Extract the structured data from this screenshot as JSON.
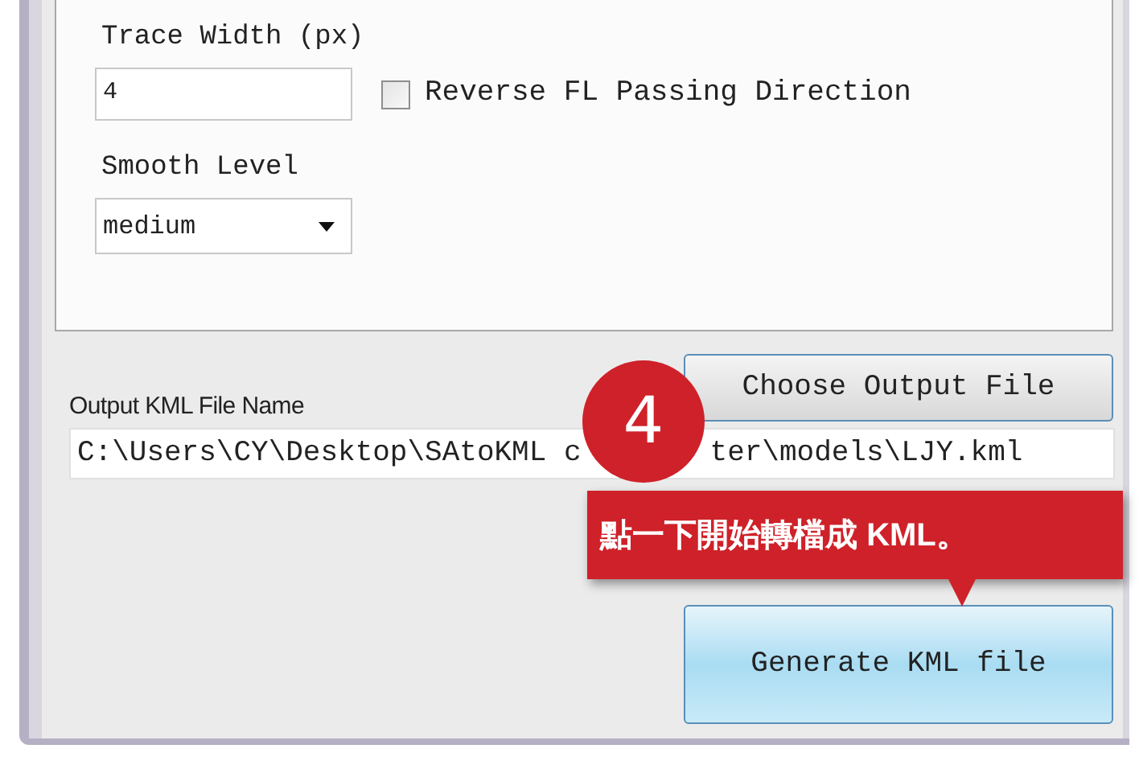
{
  "trace_width": {
    "label": "Trace Width (px)",
    "value": "4"
  },
  "reverse_checkbox": {
    "label": "Reverse FL Passing Direction",
    "checked": false
  },
  "smooth_level": {
    "label": "Smooth Level",
    "value": "medium"
  },
  "choose_button": "Choose Output File",
  "output_file": {
    "label": "Output KML File Name",
    "value_parts": [
      "C:\\Users\\CY\\Desktop\\SAtoKML c",
      "ter\\models\\LJY.kml"
    ]
  },
  "generate_button": "Generate KML file",
  "callout": {
    "step": "4",
    "text": "點一下開始轉檔成 **KML**。"
  }
}
